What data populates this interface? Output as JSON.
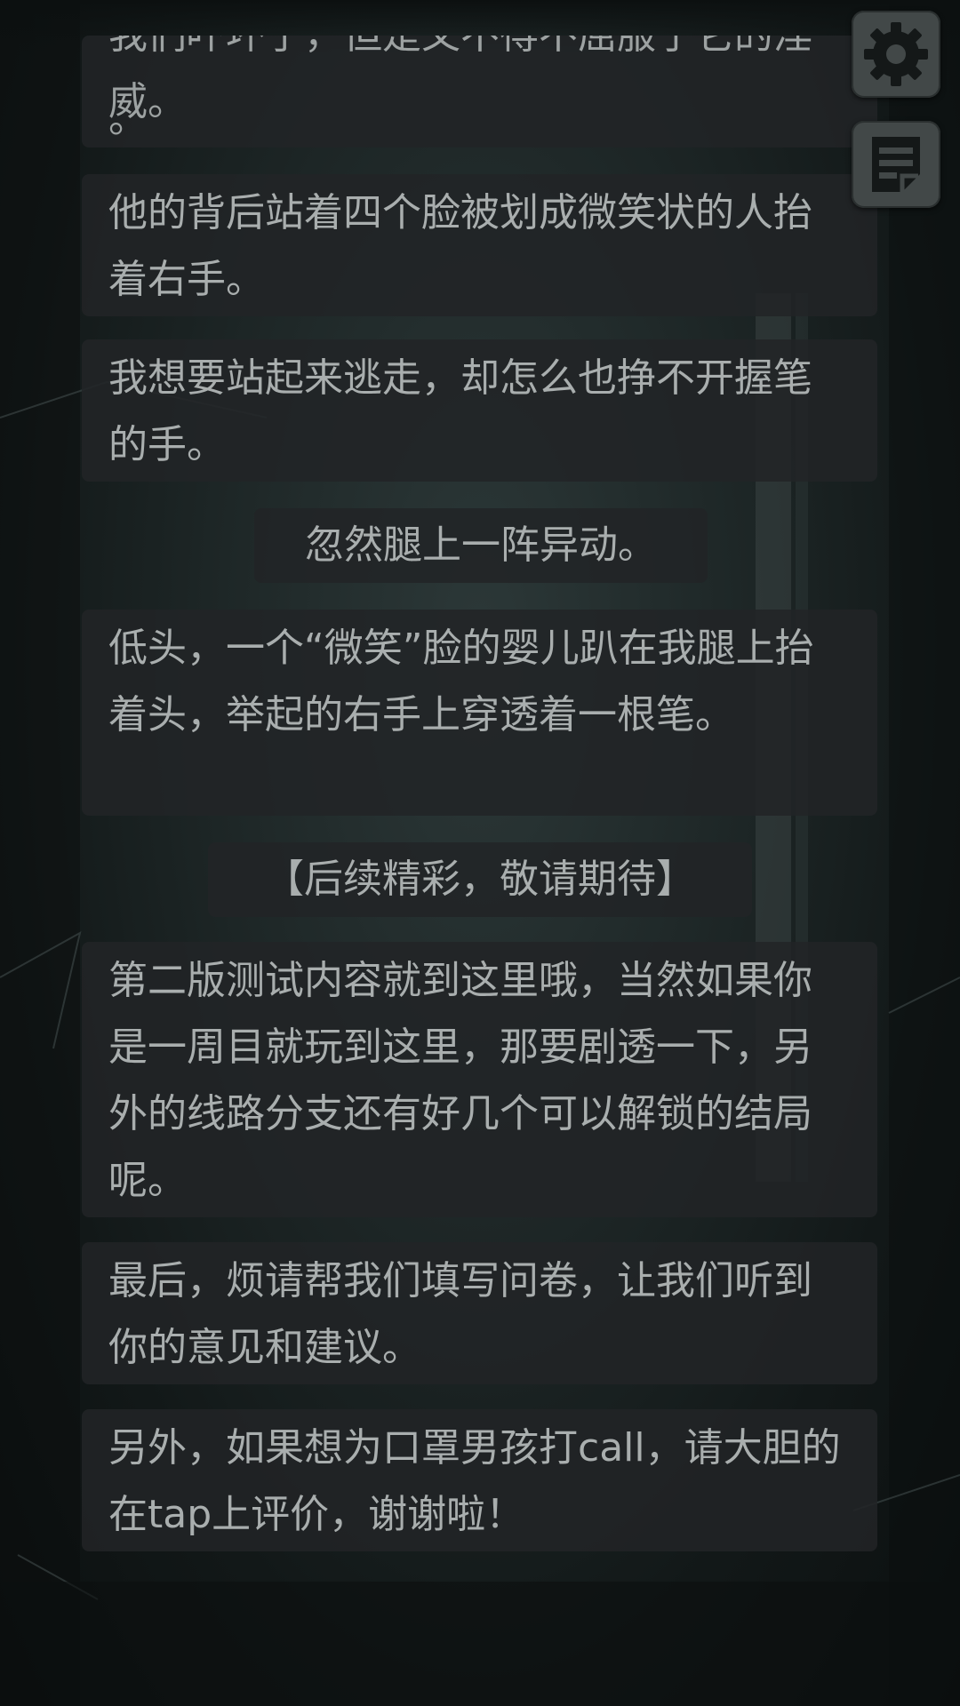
{
  "messages": [
    {
      "text": "我们吓坏了，但是又不得不屈服于它的淫威。",
      "tail": "。"
    },
    {
      "text": "他的背后站着四个脸被划成微笑状的人抬着右手。"
    },
    {
      "text": "我想要站起来逃走，却怎么也挣不开握笔的手。"
    },
    {
      "text": "忽然腿上一阵异动。"
    },
    {
      "text": "低头，一个“微笑”脸的婴儿趴在我腿上抬着头，举起的右手上穿透着一根笔。"
    },
    {
      "text": "【后续精彩，敬请期待】"
    },
    {
      "text": "第二版测试内容就到这里哦，当然如果你是一周目就玩到这里，那要剧透一下，另外的线路分支还有好几个可以解锁的结局呢。"
    },
    {
      "text": "最后，烦请帮我们填写问卷，让我们听到你的意见和建议。"
    },
    {
      "text": "另外，如果想为口罩男孩打call，请大胆的在tap上评价，谢谢啦！"
    }
  ],
  "icons": {
    "settings": "gear-icon",
    "log": "notes-icon"
  },
  "colors": {
    "bubble": "#222426",
    "text": "#a9aeae",
    "icon_button": "#424848",
    "icon_glyph": "#141818"
  }
}
